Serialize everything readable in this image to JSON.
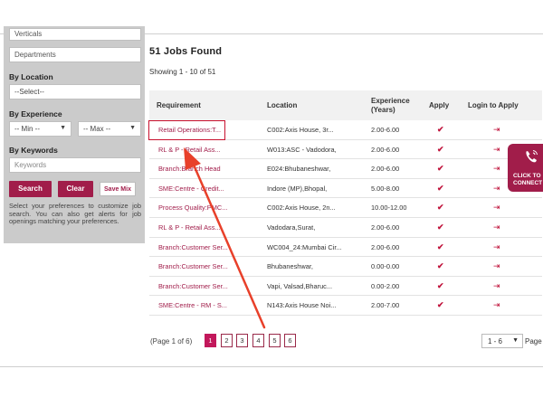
{
  "sidebar": {
    "verticals": "Verticals",
    "departments": "Departments",
    "by_location_label": "By Location",
    "location_select": "--Select--",
    "by_experience_label": "By Experience",
    "min_select": "-- Min --",
    "max_select": "-- Max --",
    "by_keywords_label": "By Keywords",
    "keywords_placeholder": "Keywords",
    "search_button": "Search",
    "clear_button": "Clear",
    "save_mix_button": "Save Mix",
    "note": "Select your preferences to customize job search. You can also get alerts for job openings matching your preferences."
  },
  "main": {
    "jobs_found": "51 Jobs Found",
    "showing": "Showing 1 - 10 of 51",
    "columns": {
      "requirement": "Requirement",
      "location": "Location",
      "experience": "Experience (Years)",
      "apply": "Apply",
      "login_apply": "Login to Apply"
    },
    "rows": [
      {
        "req": "Retail Operations:T...",
        "loc": "C002:Axis House, 3r...",
        "exp": "2.00-6.00"
      },
      {
        "req": "RL & P - Retail Ass...",
        "loc": "W013:ASC - Vadodora,",
        "exp": "2.00-6.00"
      },
      {
        "req": "Branch:Branch Head",
        "loc": "E024:Bhubaneshwar,",
        "exp": "2.00-6.00"
      },
      {
        "req": "SME:Centre - Credit...",
        "loc": "Indore (MP),Bhopal,",
        "exp": "5.00-8.00"
      },
      {
        "req": "Process Quality:PMC...",
        "loc": "C002:Axis House, 2n...",
        "exp": "10.00-12.00"
      },
      {
        "req": "RL & P - Retail Ass...",
        "loc": "Vadodara,Surat,",
        "exp": "2.00-6.00"
      },
      {
        "req": "Branch:Customer Ser...",
        "loc": "WC004_24:Mumbai Cir...",
        "exp": "2.00-6.00"
      },
      {
        "req": "Branch:Customer Ser...",
        "loc": "Bhubaneshwar,",
        "exp": "0.00-0.00"
      },
      {
        "req": "Branch:Customer Ser...",
        "loc": "Vapi, Valsad,Bharuc...",
        "exp": "0.00-2.00"
      },
      {
        "req": "SME:Centre - RM - S...",
        "loc": "N143:Axis House Noi...",
        "exp": "2.00-7.00"
      }
    ],
    "apply_glyph": "✔",
    "login_glyph": "⇥"
  },
  "pagination": {
    "info": "(Page 1 of 6)",
    "pages": [
      "1",
      "2",
      "3",
      "4",
      "5",
      "6"
    ],
    "range": "1 - 6",
    "page_word": "Page"
  },
  "connect": {
    "line1": "CLICK TO",
    "line2": "CONNECT"
  },
  "colors": {
    "brand": "#a11d4a",
    "annotation": "#e8402a"
  }
}
